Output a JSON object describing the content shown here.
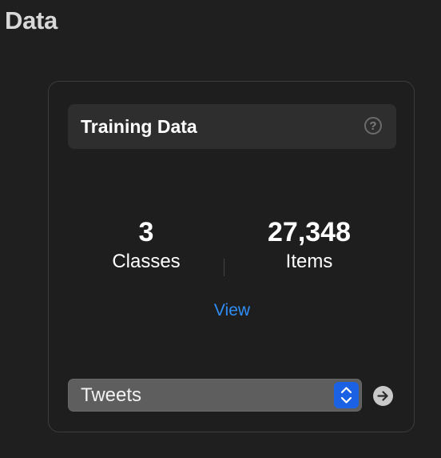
{
  "section": {
    "title": "Data"
  },
  "card": {
    "title": "Training Data",
    "help_icon": "question-mark-circle-icon",
    "stats": {
      "classes": {
        "value": "3",
        "label": "Classes"
      },
      "items": {
        "value": "27,348",
        "label": "Items"
      }
    },
    "view_link": "View",
    "dataset_select": {
      "selected": "Tweets",
      "icon": "up-down-chevron-icon"
    },
    "go_icon": "arrow-right-circle-icon"
  },
  "colors": {
    "background": "#1f1f1f",
    "card_header": "#2e2e2e",
    "link": "#2f8ef7",
    "select_stepper": "#1a62e3"
  }
}
